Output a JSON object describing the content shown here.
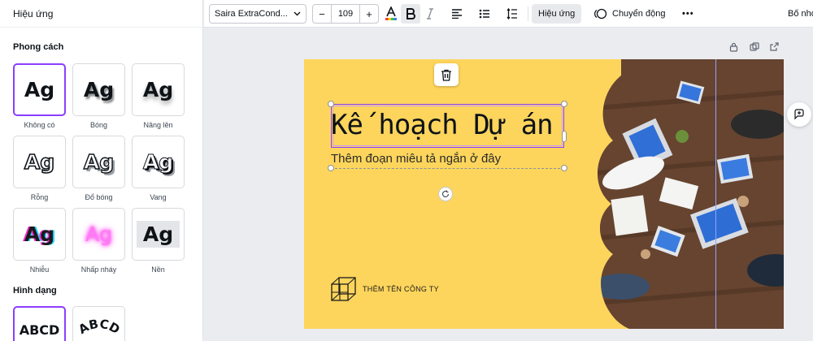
{
  "panel": {
    "title": "Hiệu ứng",
    "style_section": "Phong cách",
    "styles": [
      {
        "label": "Không có",
        "sample": "Ag",
        "selected": true
      },
      {
        "label": "Bóng",
        "sample": "Ag"
      },
      {
        "label": "Nâng lên",
        "sample": "Ag"
      },
      {
        "label": "Rỗng",
        "sample": "Ag"
      },
      {
        "label": "Đổ bóng",
        "sample": "Ag"
      },
      {
        "label": "Vang",
        "sample": "Ag"
      },
      {
        "label": "Nhiễu",
        "sample": "Ag"
      },
      {
        "label": "Nhấp nháy",
        "sample": "Ag"
      },
      {
        "label": "Nền",
        "sample": "Ag"
      }
    ],
    "shape_section": "Hình dạng",
    "shapes": [
      {
        "sample": "ABCD",
        "selected": true
      },
      {
        "sample": "ABCD"
      }
    ]
  },
  "toolbar": {
    "font_name": "Saira ExtraCond...",
    "font_size": "109",
    "decrease": "−",
    "increase": "+",
    "effects_label": "Hiệu ứng",
    "animate_label": "Chuyển động",
    "more": "•••",
    "position_label": "Bố nhó"
  },
  "canvas": {
    "title": "Kế hoạch Dự án",
    "subtitle": "Thêm đoạn miêu tả ngắn ở đây",
    "company": "THÊM TÊN CÔNG TY"
  },
  "colors": {
    "accent": "#8b3dff",
    "page_bg": "#fdd55c"
  }
}
